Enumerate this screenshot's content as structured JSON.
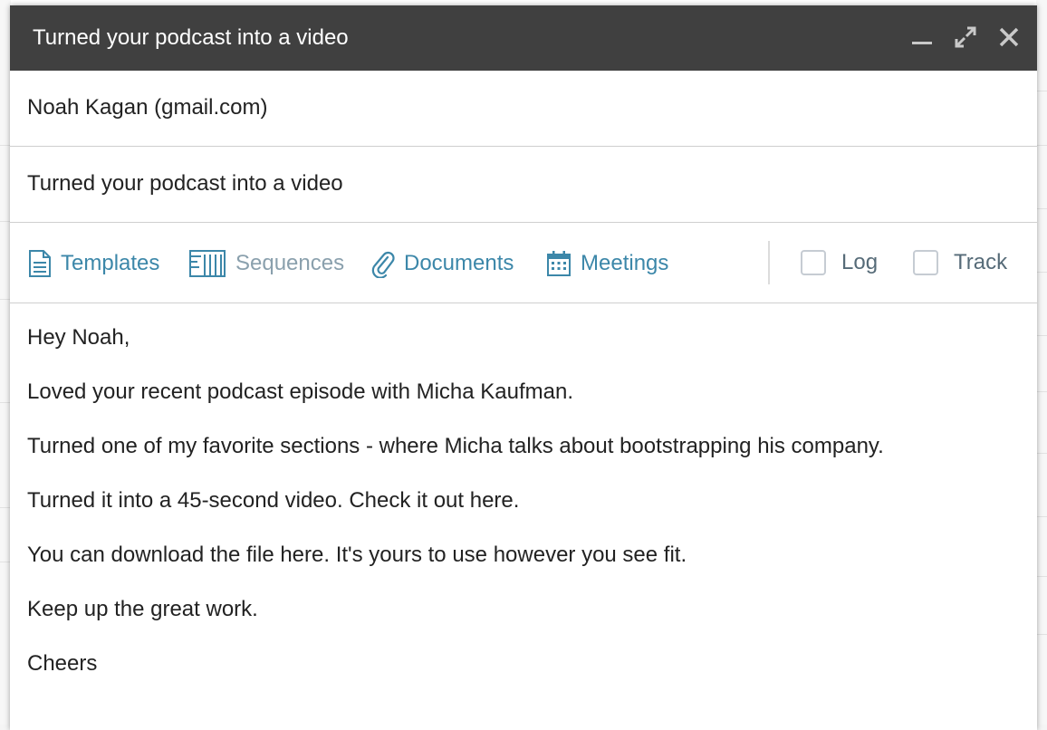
{
  "compose": {
    "title": "Turned your podcast into a video",
    "to_value": "Noah Kagan (gmail.com)",
    "subject_value": "Turned your podcast into a video"
  },
  "toolbar": {
    "templates": "Templates",
    "sequences": "Sequences",
    "documents": "Documents",
    "meetings": "Meetings",
    "log": "Log",
    "track": "Track"
  },
  "body": {
    "lines": [
      "Hey Noah,",
      "Loved your recent podcast episode with Micha Kaufman.",
      "Turned one of my favorite sections - where Micha talks about bootstrapping his company.",
      "Turned it into a 45-second video. Check it out here.",
      "You can download the file here. It's yours to use however you see fit.",
      "Keep up the great work.",
      "Cheers"
    ]
  },
  "colors": {
    "titlebar": "#404040",
    "link_blue": "#3c87a9",
    "link_grey": "#8aa0ad"
  },
  "icons": {
    "templates": "document-icon",
    "sequences": "sequences-icon",
    "documents": "paperclip-icon",
    "meetings": "calendar-icon",
    "minimize": "minimize-icon",
    "maximize": "expand-icon",
    "close": "close-icon"
  }
}
